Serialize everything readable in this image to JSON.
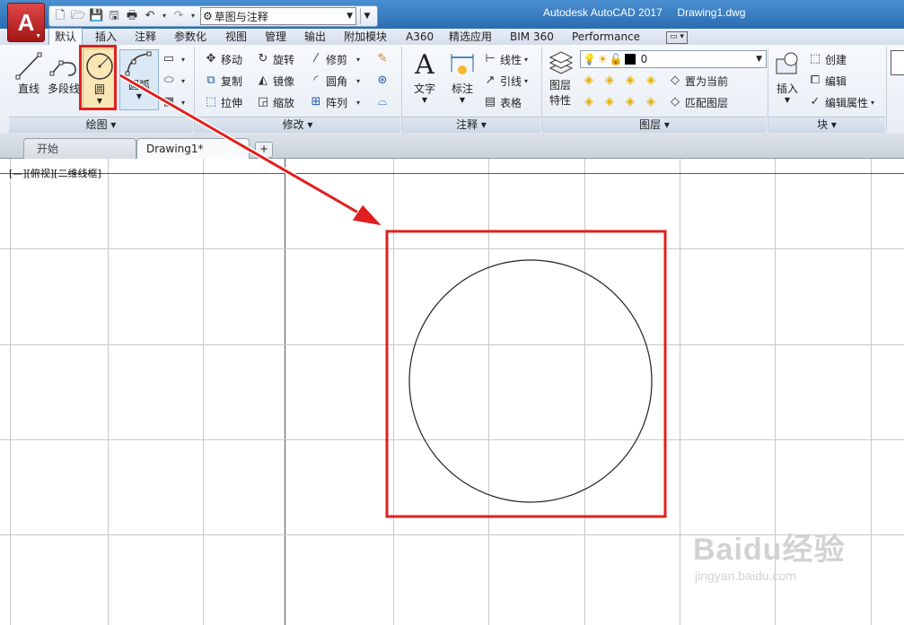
{
  "app": {
    "title": "Autodesk AutoCAD 2017     Drawing1.dwg",
    "logo_letter": "A",
    "workspace": "草图与注释"
  },
  "ribbon_tabs": [
    "默认",
    "插入",
    "注释",
    "参数化",
    "视图",
    "管理",
    "输出",
    "附加模块",
    "A360",
    "精选应用",
    "BIM 360",
    "Performance"
  ],
  "draw_panel": {
    "line": "直线",
    "polyline": "多段线",
    "circle": "圆",
    "arc": "圆弧",
    "footer": "绘图"
  },
  "modify_panel": {
    "move": "移动",
    "rotate": "旋转",
    "trim": "修剪",
    "copy": "复制",
    "mirror": "镜像",
    "fillet": "圆角",
    "stretch": "拉伸",
    "scale": "缩放",
    "array": "阵列",
    "footer": "修改"
  },
  "annotation_panel": {
    "text": "文字",
    "dimension": "标注",
    "linear": "线性",
    "leader": "引线",
    "table": "表格",
    "footer": "注释"
  },
  "layers_panel": {
    "properties_line1": "图层",
    "properties_line2": "特性",
    "current_layer": "0",
    "set_current": "置为当前",
    "match_layer": "匹配图层",
    "footer": "图层"
  },
  "block_panel": {
    "insert": "插入",
    "create": "创建",
    "edit": "编辑",
    "edit_attributes": "编辑属性",
    "footer": "块"
  },
  "file_tabs": {
    "start": "开始",
    "drawing": "Drawing1*",
    "new": "+"
  },
  "viewport_label": "[—][俯视][二维线框]",
  "colors": {
    "highlight_red": "#e02020",
    "title_blue": "#2b6cb3",
    "app_red": "#c41e1e"
  },
  "watermark": {
    "brand": "Baidu经验",
    "url": "jingyan.baidu.com"
  }
}
